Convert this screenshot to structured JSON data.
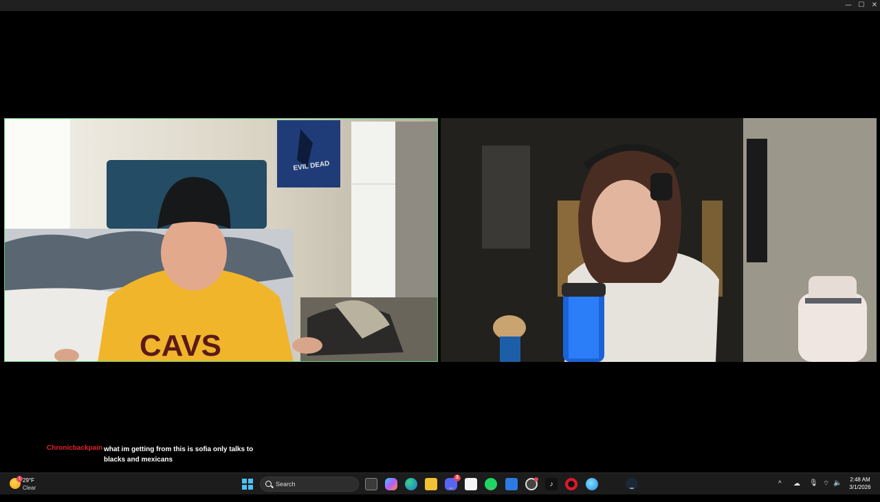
{
  "chat": {
    "username": "Chronicbackpain",
    "message": "what im getting from this is sofia only talks to blacks and mexicans",
    "username_color": "#e3242b"
  },
  "video": {
    "left_tile_border": "#5fd47a",
    "shirt_text": "CAVS",
    "poster_text": "EVIL DEAD"
  },
  "taskbar": {
    "weather": {
      "temp": "29°F",
      "condition": "Clear",
      "badge": "1"
    },
    "search_placeholder": "Search",
    "discord_badge": "3",
    "apps": [
      "start-icon",
      "file-manager-icon",
      "copilot-icon",
      "edge-icon",
      "file-explorer-icon",
      "discord-icon",
      "store-icon",
      "spotify-icon",
      "mail-icon",
      "settings-icon",
      "tiktok-icon",
      "opera-icon",
      "globe-icon",
      "steam-icon"
    ],
    "clock": {
      "time": "2:48 AM",
      "date": "3/1/2026"
    }
  }
}
